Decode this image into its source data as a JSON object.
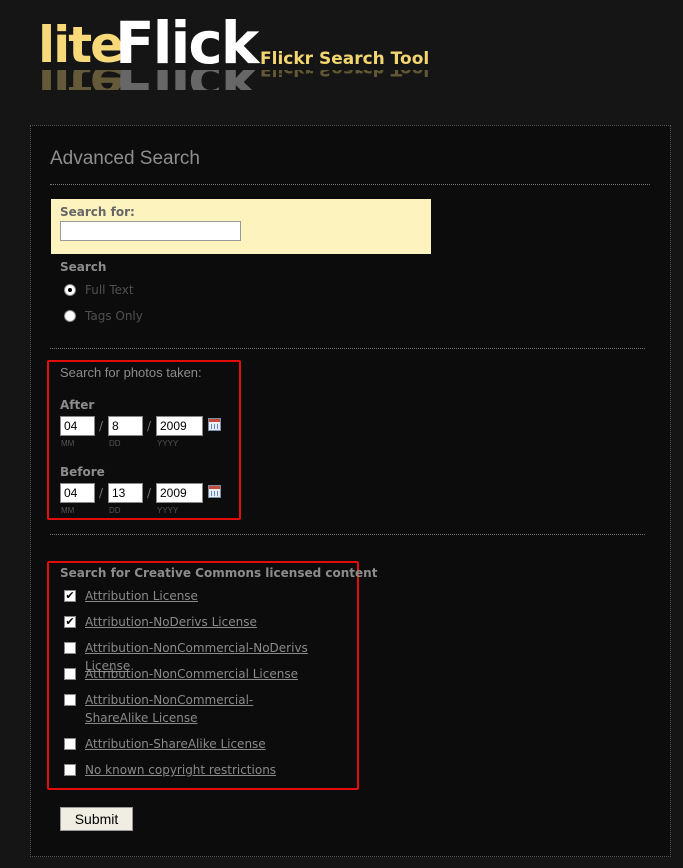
{
  "header": {
    "logo_lite": "lite",
    "logo_flick": "Flick",
    "logo_tagline": "Flickr Search Tool"
  },
  "page_title": "Advanced Search",
  "search": {
    "label": "Search for:",
    "value": "",
    "mode_label": "Search",
    "modes": [
      {
        "label": "Full Text",
        "selected": true
      },
      {
        "label": "Tags Only",
        "selected": false
      }
    ]
  },
  "dates": {
    "title": "Search for photos taken:",
    "after": {
      "label": "After",
      "mm": "04",
      "dd": "8",
      "yyyy": "2009"
    },
    "before": {
      "label": "Before",
      "mm": "04",
      "dd": "13",
      "yyyy": "2009"
    },
    "sublabels": {
      "mm": "MM",
      "dd": "DD",
      "yyyy": "YYYY"
    },
    "separator": "/"
  },
  "licenses": {
    "title": "Search for Creative Commons licensed content",
    "items": [
      {
        "label": "Attribution License",
        "checked": true
      },
      {
        "label": "Attribution-NoDerivs License",
        "checked": true
      },
      {
        "label": "Attribution-NonCommercial-NoDerivs License",
        "checked": false
      },
      {
        "label": "Attribution-NonCommercial License",
        "checked": false
      },
      {
        "label": "Attribution-NonCommercial-ShareAlike License",
        "checked": false
      },
      {
        "label": "Attribution-ShareAlike License",
        "checked": false
      },
      {
        "label": "No known copyright restrictions",
        "checked": false
      }
    ]
  },
  "submit_label": "Submit",
  "icons": {
    "calendar": "calendar-icon",
    "check": "✔"
  }
}
